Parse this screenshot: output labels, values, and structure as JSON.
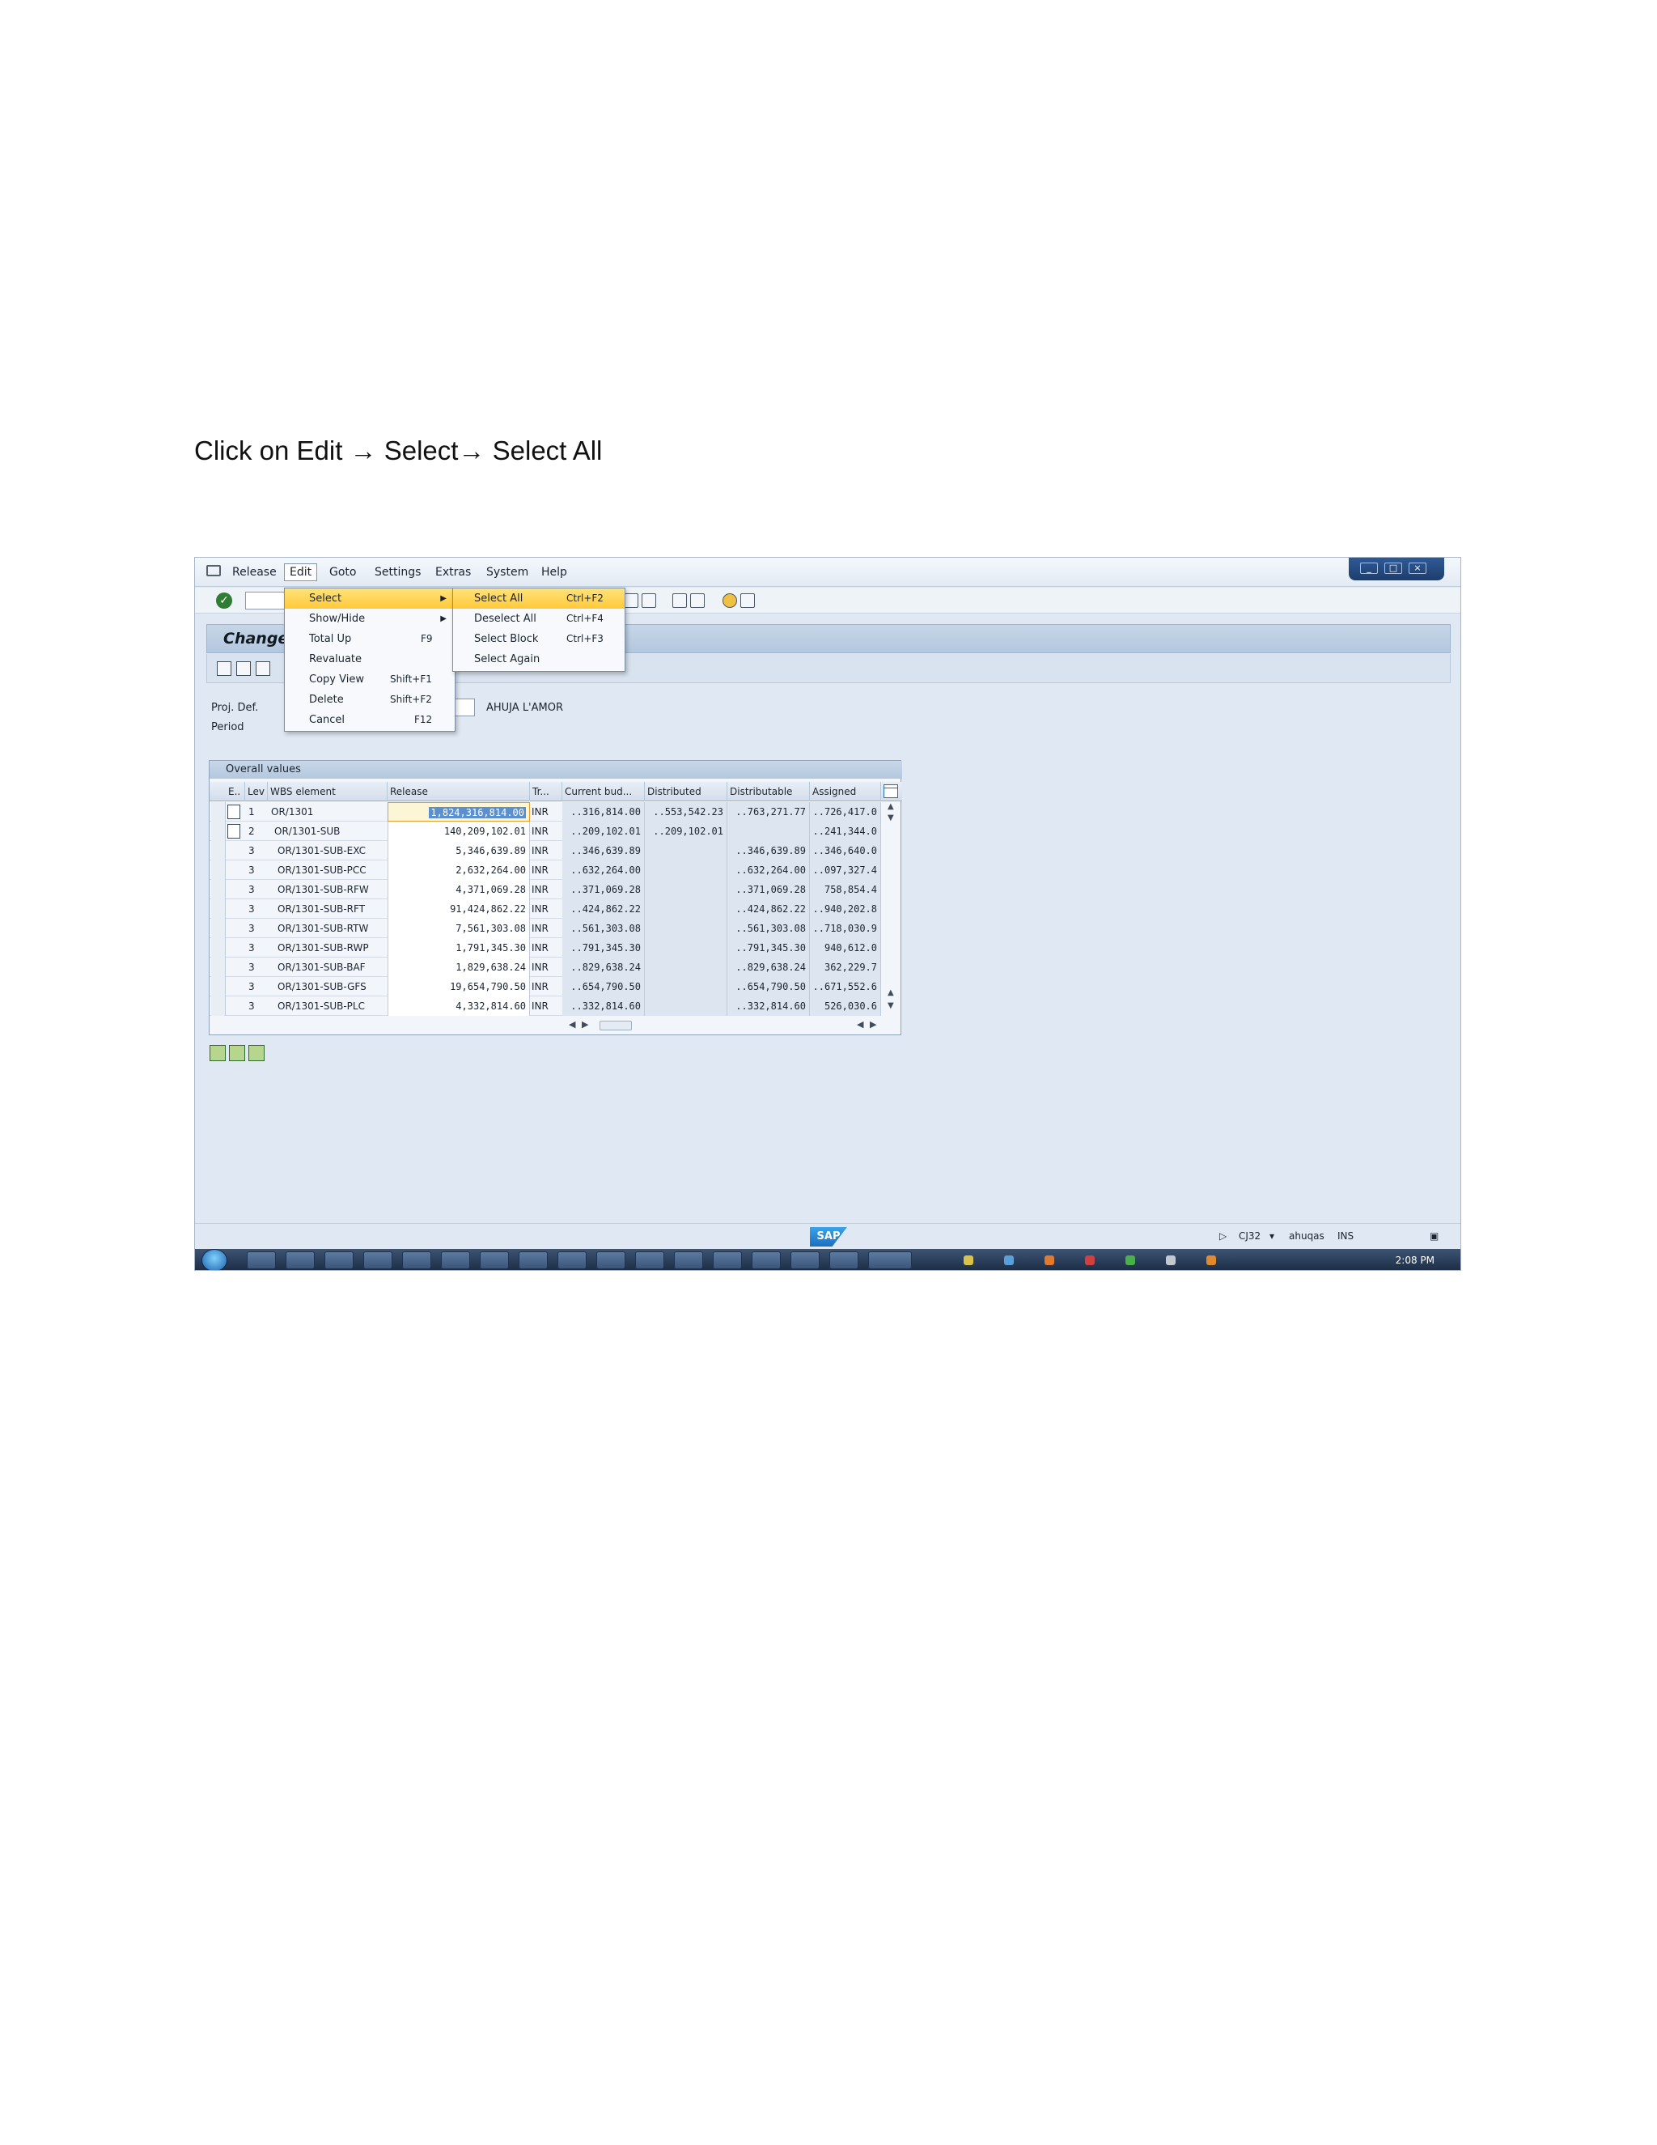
{
  "instruction": "Click on Edit → Select→ Select All",
  "menubar": {
    "items": [
      "Release",
      "Edit",
      "Goto",
      "Settings",
      "Extras",
      "System",
      "Help"
    ]
  },
  "title": "Change",
  "form": {
    "proj_def_label": "Proj. Def.",
    "period_label": "Period",
    "proj_def_value": "AHUJA  L'AMOR"
  },
  "edit_menu": {
    "items": [
      {
        "label": "Select",
        "shortcut": "",
        "submenu": true
      },
      {
        "label": "Show/Hide",
        "shortcut": "",
        "submenu": true
      },
      {
        "label": "Total Up",
        "shortcut": "F9"
      },
      {
        "label": "Revaluate",
        "shortcut": ""
      },
      {
        "label": "Copy View",
        "shortcut": "Shift+F1"
      },
      {
        "label": "Delete",
        "shortcut": "Shift+F2"
      },
      {
        "label": "Cancel",
        "shortcut": "F12"
      }
    ]
  },
  "select_menu": {
    "items": [
      {
        "label": "Select All",
        "shortcut": "Ctrl+F2"
      },
      {
        "label": "Deselect All",
        "shortcut": "Ctrl+F4"
      },
      {
        "label": "Select Block",
        "shortcut": "Ctrl+F3"
      },
      {
        "label": "Select Again",
        "shortcut": ""
      }
    ]
  },
  "table": {
    "caption": "Overall values",
    "columns": [
      "E..",
      "Lev",
      "WBS element",
      "Release",
      "Tr...",
      "Current bud...",
      "Distributed",
      "Distributable",
      "Assigned"
    ],
    "rows": [
      {
        "lev": "1",
        "wbs": "OR/1301",
        "release": "1,824,316,814.00",
        "tr": "INR",
        "current": "..316,814.00",
        "distributed": "..553,542.23",
        "distributable": "..763,271.77",
        "assigned": "..726,417.0"
      },
      {
        "lev": "2",
        "wbs": "OR/1301-SUB",
        "release": "140,209,102.01",
        "tr": "INR",
        "current": "..209,102.01",
        "distributed": "..209,102.01",
        "distributable": "",
        "assigned": "..241,344.0"
      },
      {
        "lev": "3",
        "wbs": "OR/1301-SUB-EXC",
        "release": "5,346,639.89",
        "tr": "INR",
        "current": "..346,639.89",
        "distributed": "",
        "distributable": "..346,639.89",
        "assigned": "..346,640.0"
      },
      {
        "lev": "3",
        "wbs": "OR/1301-SUB-PCC",
        "release": "2,632,264.00",
        "tr": "INR",
        "current": "..632,264.00",
        "distributed": "",
        "distributable": "..632,264.00",
        "assigned": "..097,327.4"
      },
      {
        "lev": "3",
        "wbs": "OR/1301-SUB-RFW",
        "release": "4,371,069.28",
        "tr": "INR",
        "current": "..371,069.28",
        "distributed": "",
        "distributable": "..371,069.28",
        "assigned": "758,854.4"
      },
      {
        "lev": "3",
        "wbs": "OR/1301-SUB-RFT",
        "release": "91,424,862.22",
        "tr": "INR",
        "current": "..424,862.22",
        "distributed": "",
        "distributable": "..424,862.22",
        "assigned": "..940,202.8"
      },
      {
        "lev": "3",
        "wbs": "OR/1301-SUB-RTW",
        "release": "7,561,303.08",
        "tr": "INR",
        "current": "..561,303.08",
        "distributed": "",
        "distributable": "..561,303.08",
        "assigned": "..718,030.9"
      },
      {
        "lev": "3",
        "wbs": "OR/1301-SUB-RWP",
        "release": "1,791,345.30",
        "tr": "INR",
        "current": "..791,345.30",
        "distributed": "",
        "distributable": "..791,345.30",
        "assigned": "940,612.0"
      },
      {
        "lev": "3",
        "wbs": "OR/1301-SUB-BAF",
        "release": "1,829,638.24",
        "tr": "INR",
        "current": "..829,638.24",
        "distributed": "",
        "distributable": "..829,638.24",
        "assigned": "362,229.7"
      },
      {
        "lev": "3",
        "wbs": "OR/1301-SUB-GFS",
        "release": "19,654,790.50",
        "tr": "INR",
        "current": "..654,790.50",
        "distributed": "",
        "distributable": "..654,790.50",
        "assigned": "..671,552.6"
      },
      {
        "lev": "3",
        "wbs": "OR/1301-SUB-PLC",
        "release": "4,332,814.60",
        "tr": "INR",
        "current": "..332,814.60",
        "distributed": "",
        "distributable": "..332,814.60",
        "assigned": "526,030.6"
      }
    ]
  },
  "statusbar": {
    "sap_logo": "SAP",
    "transaction": "CJ32",
    "user": "ahuqas",
    "mode": "INS"
  },
  "taskbar": {
    "clock": "2:08 PM"
  }
}
